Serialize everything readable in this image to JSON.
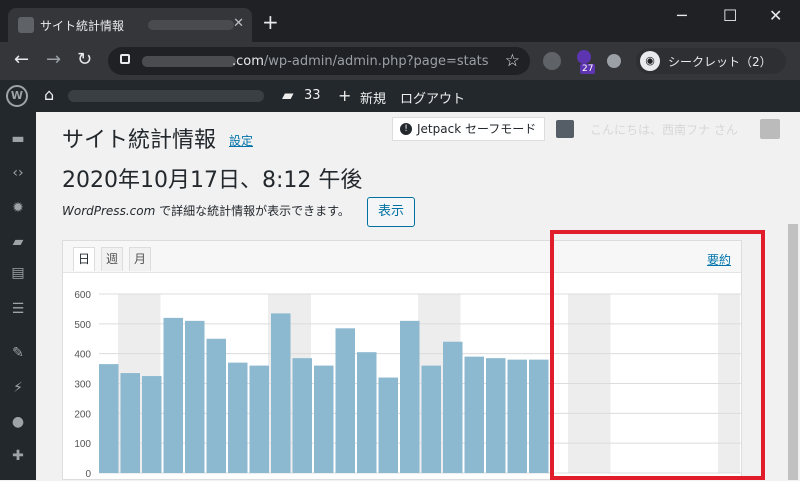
{
  "browser": {
    "tab_title": "サイト統計情報",
    "tab_close": "✕",
    "new_tab": "+",
    "url_host": ".com",
    "url_path": "/wp-admin/admin.php?page=stats",
    "extension_badge": "27",
    "incognito_label": "シークレット（2）",
    "window_minimize": "─",
    "window_maximize": "☐",
    "window_close": "✕"
  },
  "admin_bar": {
    "comments_count": "33",
    "new_label": "新規",
    "logout_label": "ログアウト"
  },
  "header": {
    "title": "サイト統計情報",
    "settings_link": "設定",
    "jetpack_badge": "Jetpack セーフモード",
    "greeting": "こんにちは、西南フナ さん"
  },
  "main": {
    "datetime": "2020年10月17日、8:12 午後",
    "info_brand": "WordPress.com",
    "info_text": " で詳細な統計情報が表示できます。",
    "show_button": "表示"
  },
  "stats_panel": {
    "tabs": [
      "日",
      "週",
      "月"
    ],
    "summary_link": "要約"
  },
  "chart_data": {
    "type": "bar",
    "values": [
      365,
      335,
      325,
      520,
      510,
      450,
      370,
      360,
      535,
      385,
      360,
      485,
      405,
      320,
      510,
      360,
      440,
      390,
      385,
      380,
      380
    ],
    "ylim": [
      0,
      600
    ],
    "yticks": [
      0,
      100,
      200,
      300,
      400,
      500,
      600
    ],
    "color": "#8cb9d0",
    "grid": true
  }
}
